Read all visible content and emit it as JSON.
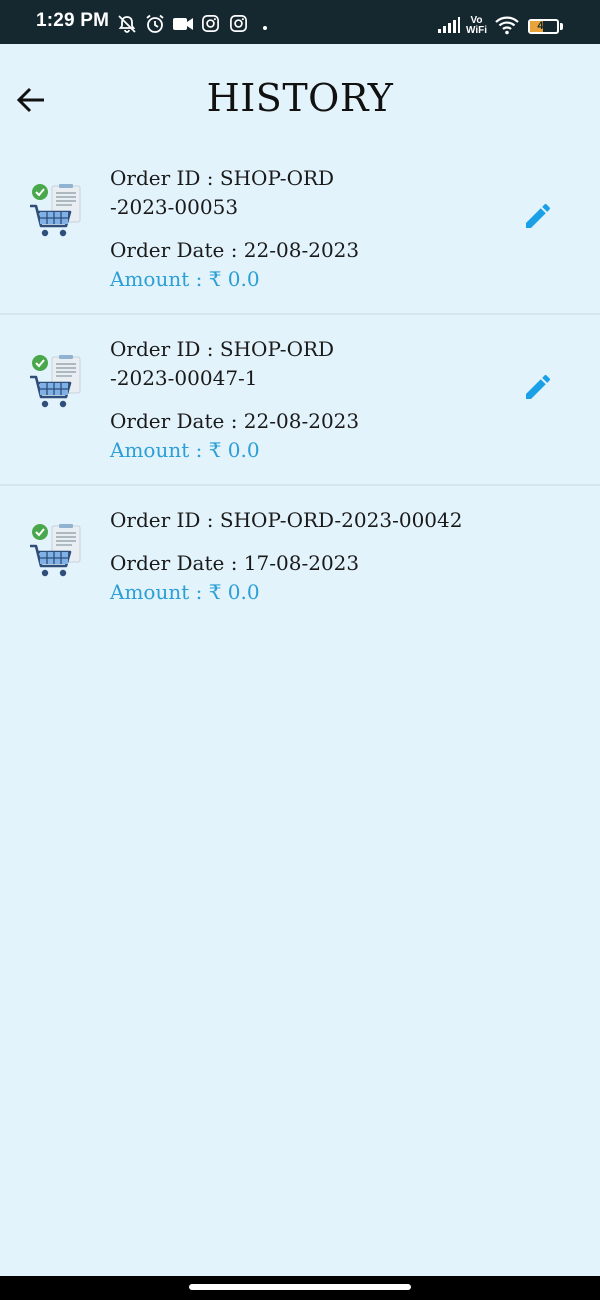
{
  "status_bar": {
    "time": "1:29 PM",
    "volte_line1": "Vo",
    "volte_line2": "WiFi",
    "battery_level": "47",
    "battery_fraction": 0.47,
    "icons": [
      "bell-off-icon",
      "alarm-icon",
      "video-icon",
      "instagram-icon",
      "instagram-icon",
      "signal-icon",
      "wifi-icon",
      "battery-icon"
    ]
  },
  "header": {
    "title": "HISTORY",
    "back_icon": "arrow-left-icon"
  },
  "orders": [
    {
      "id_label": "Order ID  :  SHOP-ORD-2023-00053",
      "date_label": "Order Date : 22-08-2023",
      "amount_label": "Amount : ₹ 0.0",
      "editable": true
    },
    {
      "id_label": "Order ID  :  SHOP-ORD-2023-00047-1",
      "date_label": "Order Date : 22-08-2023",
      "amount_label": "Amount : ₹ 0.0",
      "editable": true
    },
    {
      "id_label": "Order ID  :  SHOP-ORD-2023-00042",
      "date_label": "Order Date : 17-08-2023",
      "amount_label": "Amount : ₹ 0.0",
      "editable": false
    }
  ],
  "colors": {
    "background": "#e3f3fb",
    "status_bar": "#15272f",
    "amount_text": "#2c9fd6",
    "edit_icon": "#1aa0e6",
    "battery_fill": "#e8a33a"
  }
}
